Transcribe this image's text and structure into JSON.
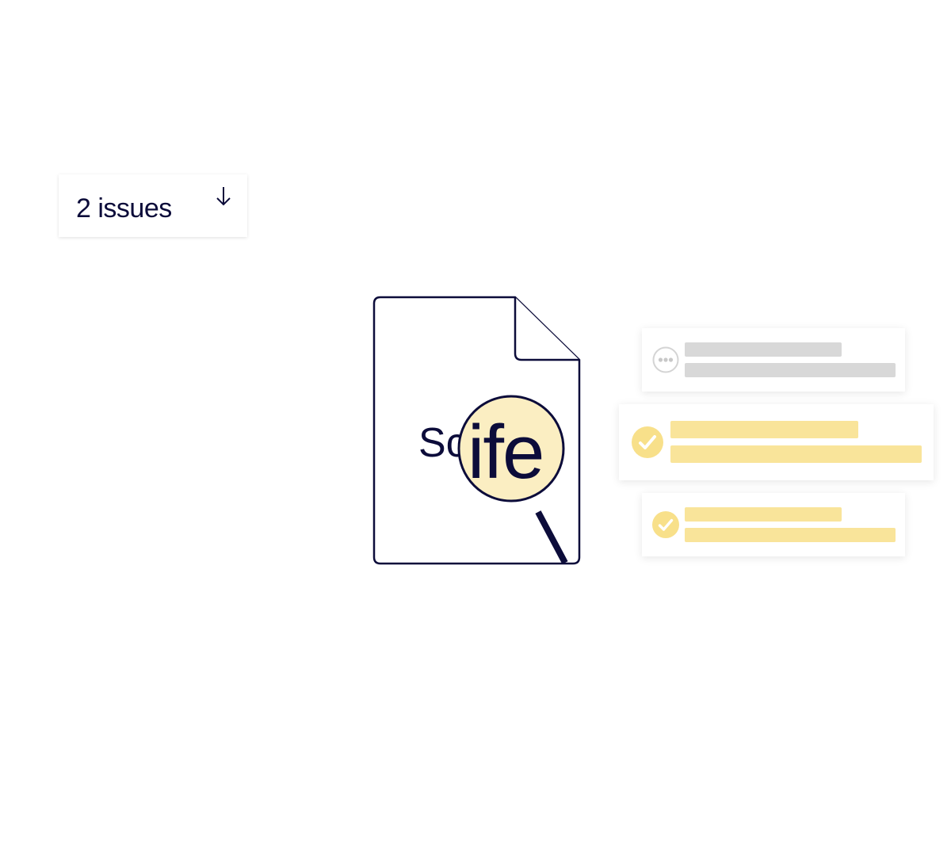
{
  "issues_button": {
    "label": "2 issues",
    "icon": "arrow-down-icon"
  },
  "document": {
    "text_visible": "Sc",
    "magnified_text": "ife"
  },
  "results": [
    {
      "state": "pending",
      "icon": "ellipsis-icon",
      "accent": "#d8d8d8"
    },
    {
      "state": "resolved",
      "icon": "check-circle-icon",
      "accent": "#f9e49a"
    },
    {
      "state": "resolved",
      "icon": "check-circle-icon",
      "accent": "#f9e49a"
    }
  ],
  "colors": {
    "ink": "#0c0c3a",
    "highlight": "#fbeec2",
    "placeholder_grey": "#d8d8d8",
    "placeholder_yellow": "#f9e49a",
    "check_yellow": "#f8e08a"
  }
}
